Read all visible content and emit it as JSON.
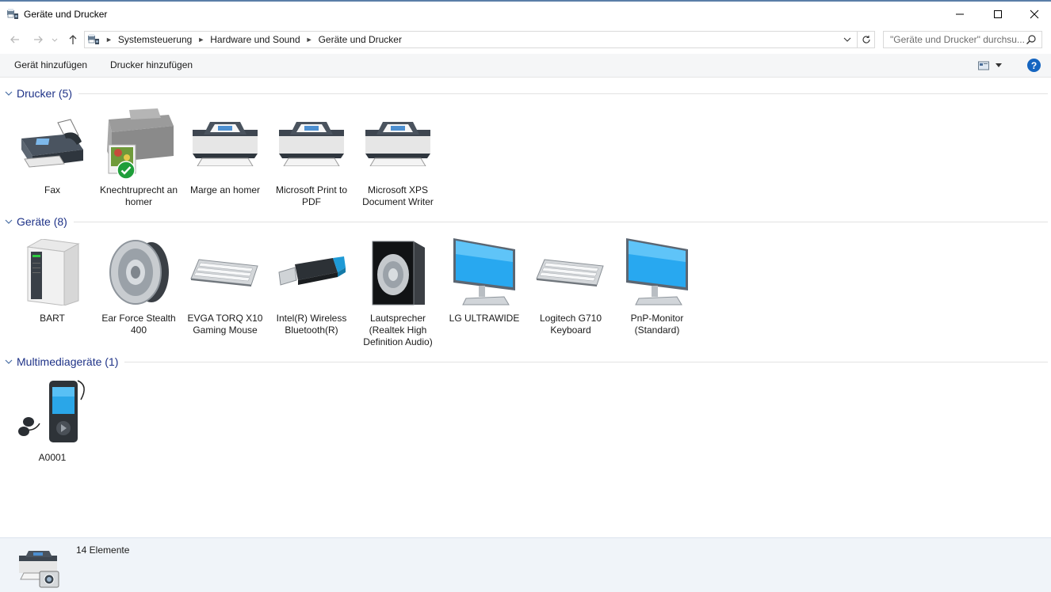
{
  "window": {
    "title": "Geräte und Drucker",
    "icon": "devices-printers-icon",
    "controls": [
      "minimize-icon",
      "maximize-icon",
      "close-icon"
    ]
  },
  "address": {
    "breadcrumbs": [
      "Systemsteuerung",
      "Hardware und Sound",
      "Geräte und Drucker"
    ],
    "search_placeholder": "\"Geräte und Drucker\" durchsu..."
  },
  "toolbar": {
    "add_device": "Gerät hinzufügen",
    "add_printer": "Drucker hinzufügen"
  },
  "groups": [
    {
      "title": "Drucker (5)",
      "items": [
        {
          "label": "Fax",
          "icon": "fax-icon"
        },
        {
          "label": "Knechtruprecht an homer",
          "icon": "photo-printer-icon",
          "default": true
        },
        {
          "label": "Marge an homer",
          "icon": "printer-icon"
        },
        {
          "label": "Microsoft Print to PDF",
          "icon": "printer-icon"
        },
        {
          "label": "Microsoft XPS Document Writer",
          "icon": "printer-icon"
        }
      ]
    },
    {
      "title": "Geräte (8)",
      "items": [
        {
          "label": "BART",
          "icon": "computer-tower-icon"
        },
        {
          "label": "Ear Force Stealth 400",
          "icon": "speaker-icon"
        },
        {
          "label": "EVGA TORQ X10 Gaming Mouse",
          "icon": "keyboard-icon"
        },
        {
          "label": "Intel(R) Wireless Bluetooth(R)",
          "icon": "usb-dongle-icon"
        },
        {
          "label": "Lautsprecher (Realtek High Definition Audio)",
          "icon": "speaker-box-icon"
        },
        {
          "label": "LG ULTRAWIDE",
          "icon": "monitor-icon"
        },
        {
          "label": "Logitech G710 Keyboard",
          "icon": "keyboard-icon"
        },
        {
          "label": "PnP-Monitor (Standard)",
          "icon": "monitor-icon"
        }
      ]
    },
    {
      "title": "Multimediageräte (1)",
      "items": [
        {
          "label": "A0001",
          "icon": "media-player-icon"
        }
      ]
    }
  ],
  "status": {
    "count_text": "14 Elemente"
  },
  "colors": {
    "group_title": "#1e3287",
    "help": "#1565c0",
    "statusbar_bg": "#f0f4f9"
  }
}
